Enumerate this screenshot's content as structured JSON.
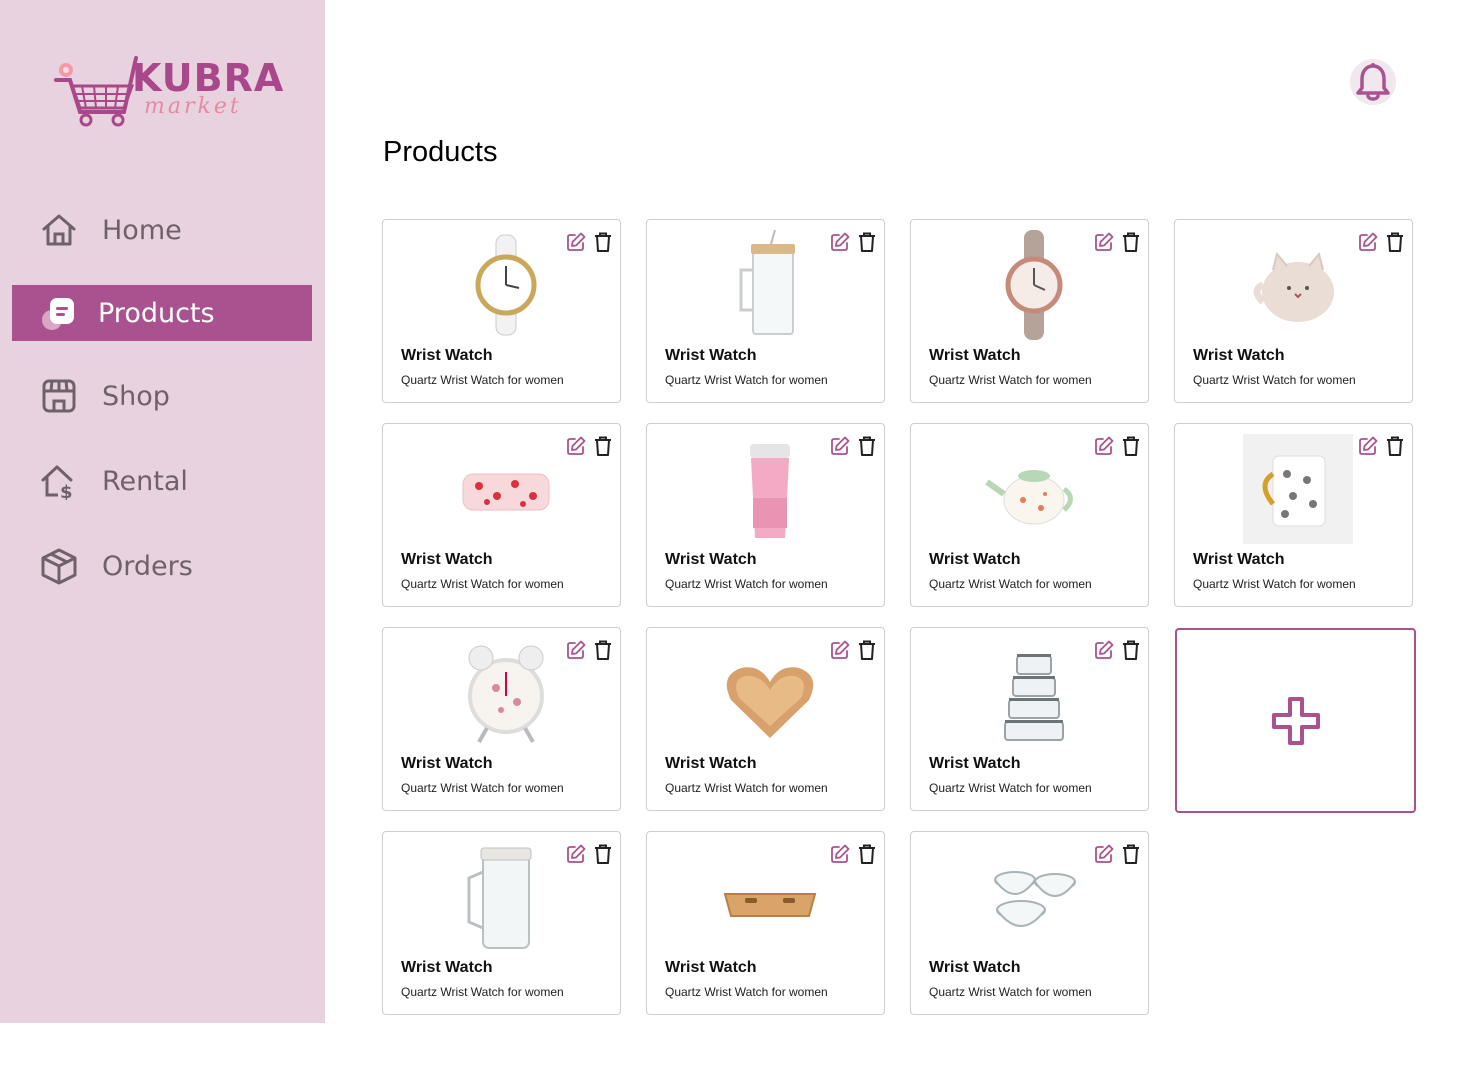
{
  "brand": {
    "name": "KUBRA",
    "subtitle": "market",
    "color": "#a8488a"
  },
  "sidebar": {
    "items": [
      {
        "label": "Home",
        "icon": "home-icon",
        "active": false
      },
      {
        "label": "Products",
        "icon": "products-icon",
        "active": true
      },
      {
        "label": "Shop",
        "icon": "shop-icon",
        "active": false
      },
      {
        "label": "Rental",
        "icon": "rental-icon",
        "active": false
      },
      {
        "label": "Orders",
        "icon": "orders-icon",
        "active": false
      }
    ]
  },
  "header": {
    "notification_icon": "bell-icon"
  },
  "main": {
    "title": "Products",
    "products": [
      {
        "name": "Wrist Watch",
        "description": "Quartz Wrist Watch for women",
        "image": "white-watch"
      },
      {
        "name": "Wrist Watch",
        "description": "Quartz Wrist Watch for women",
        "image": "glass-jar"
      },
      {
        "name": "Wrist Watch",
        "description": "Quartz Wrist Watch for women",
        "image": "brown-watch"
      },
      {
        "name": "Wrist Watch",
        "description": "Quartz Wrist Watch for women",
        "image": "cat-mug"
      },
      {
        "name": "Wrist Watch",
        "description": "Quartz Wrist Watch for women",
        "image": "heart-blanket"
      },
      {
        "name": "Wrist Watch",
        "description": "Quartz Wrist Watch for women",
        "image": "pink-tumbler"
      },
      {
        "name": "Wrist Watch",
        "description": "Quartz Wrist Watch for women",
        "image": "teapot"
      },
      {
        "name": "Wrist Watch",
        "description": "Quartz Wrist Watch for women",
        "image": "cat-print-mug"
      },
      {
        "name": "Wrist Watch",
        "description": "Quartz Wrist Watch for women",
        "image": "alarm-clock"
      },
      {
        "name": "Wrist Watch",
        "description": "Quartz Wrist Watch for women",
        "image": "heart-tray"
      },
      {
        "name": "Wrist Watch",
        "description": "Quartz Wrist Watch for women",
        "image": "glass-containers"
      },
      {
        "name": "Wrist Watch",
        "description": "Quartz Wrist Watch for women",
        "image": "glass-pitcher"
      },
      {
        "name": "Wrist Watch",
        "description": "Quartz Wrist Watch for women",
        "image": "bamboo-tray"
      },
      {
        "name": "Wrist Watch",
        "description": "Quartz Wrist Watch for women",
        "image": "bowl-set"
      }
    ],
    "add_icon": "plus-icon"
  },
  "colors": {
    "sidebar_bg": "#e8d2df",
    "accent": "#a9528f",
    "nav_text": "#6f6169"
  }
}
